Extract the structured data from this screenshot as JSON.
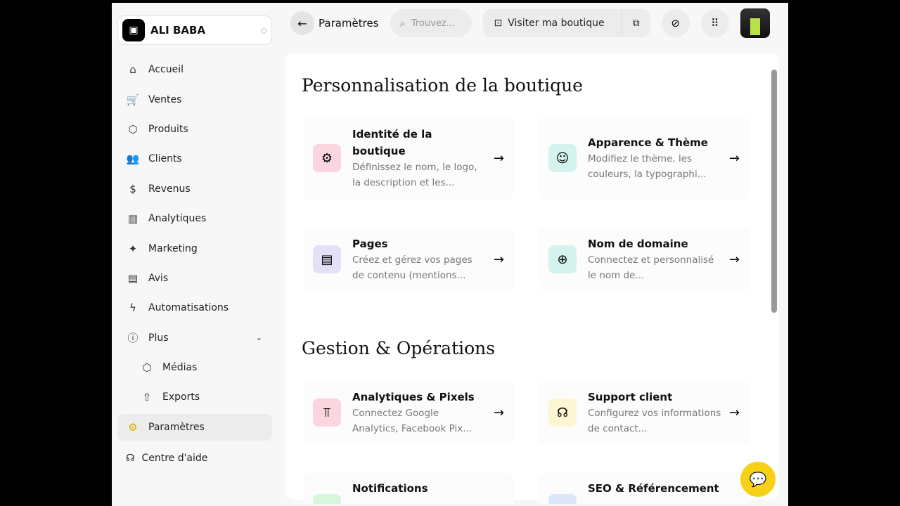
{
  "store": {
    "name": "ALI BABA"
  },
  "nav": [
    {
      "label": "Accueil",
      "icon": "home-icon",
      "g": "⌂"
    },
    {
      "label": "Ventes",
      "icon": "basket-icon",
      "g": "🛒"
    },
    {
      "label": "Produits",
      "icon": "box-icon",
      "g": "⬡"
    },
    {
      "label": "Clients",
      "icon": "users-icon",
      "g": "👥"
    },
    {
      "label": "Revenus",
      "icon": "revenue-icon",
      "g": "$"
    },
    {
      "label": "Analytiques",
      "icon": "chart-icon",
      "g": "▥"
    },
    {
      "label": "Marketing",
      "icon": "marketing-icon",
      "g": "✦"
    },
    {
      "label": "Avis",
      "icon": "message-icon",
      "g": "▤"
    },
    {
      "label": "Automatisations",
      "icon": "bolt-icon",
      "g": "ϟ"
    },
    {
      "label": "Plus",
      "icon": "more-icon",
      "g": "ⓘ"
    },
    {
      "label": "Médias",
      "icon": "media-icon",
      "g": "⬡"
    },
    {
      "label": "Exports",
      "icon": "export-icon",
      "g": "⇧"
    },
    {
      "label": "Paramètres",
      "icon": "gear-icon",
      "g": "⚙"
    }
  ],
  "help": "Centre d'aide",
  "topbar": {
    "title": "Paramètres",
    "search_placeholder": "Trouvez...",
    "visit": "Visiter ma boutique"
  },
  "sections": [
    {
      "title": "Personnalisation de la boutique"
    },
    {
      "title": "Gestion & Opérations"
    }
  ],
  "cards": [
    {
      "title": "Identité de la boutique",
      "desc": "Définissez le nom, le logo, la description et les...",
      "icon": "gear-icon",
      "color": "#fbd5df",
      "g": "⚙"
    },
    {
      "title": "Apparence & Thème",
      "desc": "Modifiez le thème, les couleurs, la typographi...",
      "icon": "store-icon",
      "color": "#d4f3ee",
      "g": "☺"
    },
    {
      "title": "Pages",
      "desc": "Créez et gérez vos pages de contenu (mentions...",
      "icon": "page-icon",
      "color": "#e4e0f7",
      "g": "▤"
    },
    {
      "title": "Nom de domaine",
      "desc": "Connectez et personnalisé le nom de...",
      "icon": "globe-icon",
      "color": "#d4f3ee",
      "g": "⊕"
    },
    {
      "title": "Analytiques & Pixels",
      "desc": "Connectez Google Analytics, Facebook Pix...",
      "icon": "analytics-icon",
      "color": "#fbd5df",
      "g": "⫪"
    },
    {
      "title": "Support client",
      "desc": "Configurez vos informations de contact...",
      "icon": "headset-icon",
      "color": "#fdf6d3",
      "g": "☊"
    },
    {
      "title": "Notifications",
      "desc": "",
      "icon": "bell-icon",
      "color": "#d6f7dc",
      "g": ""
    },
    {
      "title": "SEO & Référencement",
      "desc": "",
      "icon": "seo-icon",
      "color": "#dce8f8",
      "g": ""
    }
  ]
}
